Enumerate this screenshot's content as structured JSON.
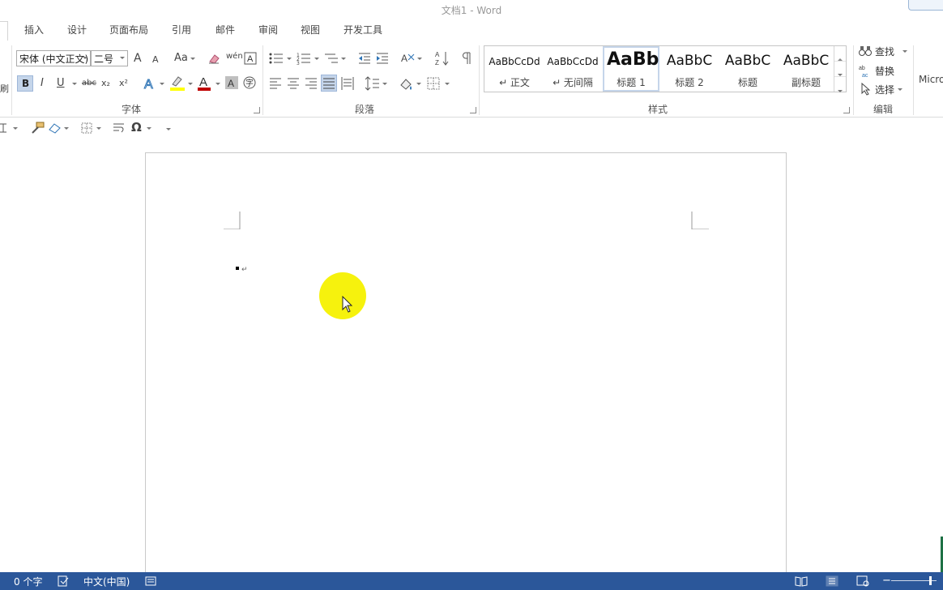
{
  "window": {
    "title": "文档1 - Word"
  },
  "tabs": [
    "插入",
    "设计",
    "页面布局",
    "引用",
    "邮件",
    "审阅",
    "视图",
    "开发工具"
  ],
  "font_group": {
    "font_name": "宋体 (中文正文)",
    "font_size": "二号",
    "grow_label": "A",
    "shrink_label": "A",
    "case_label": "Aa",
    "phonetic_label": "wén",
    "bold": "B",
    "italic": "I",
    "underline": "U",
    "strike": "abc",
    "subscript": "x₂",
    "superscript": "x²",
    "label": "字体"
  },
  "paragraph_group": {
    "label": "段落"
  },
  "styles_group": {
    "label": "样式",
    "items": [
      {
        "preview": "AaBbCcDd",
        "name": "↵ 正文"
      },
      {
        "preview": "AaBbCcDd",
        "name": "↵ 无间隔"
      },
      {
        "preview": "AaBb",
        "name": "标题 1"
      },
      {
        "preview": "AaBbC",
        "name": "标题 2"
      },
      {
        "preview": "AaBbC",
        "name": "标题"
      },
      {
        "preview": "AaBbC",
        "name": "副标题"
      }
    ]
  },
  "editing_group": {
    "label": "编辑",
    "find": "查找",
    "replace": "替换",
    "select": "选择"
  },
  "cut_off_right": "Micro",
  "cut_off_left": "刷",
  "document": {
    "pilcrow": "↵"
  },
  "status": {
    "word_count": "0 个字",
    "language": "中文(中国)"
  },
  "colors": {
    "statusbar": "#2b579a",
    "highlight_cursor": "#f5f100",
    "font_color": "#c00000",
    "highlight_color": "#ffff00"
  }
}
